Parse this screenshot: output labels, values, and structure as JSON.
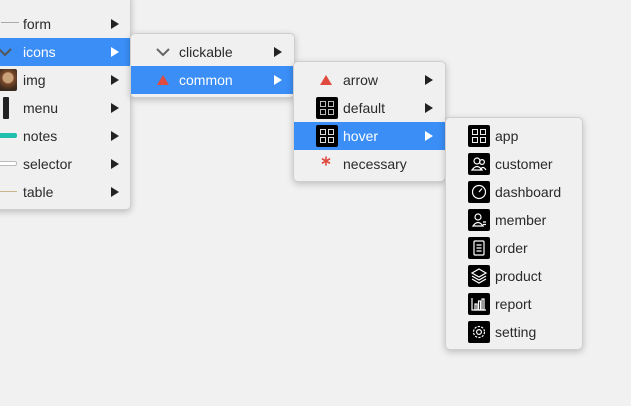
{
  "menu1": {
    "items": [
      {
        "label": "form"
      },
      {
        "label": "icons"
      },
      {
        "label": "img"
      },
      {
        "label": "menu"
      },
      {
        "label": "notes"
      },
      {
        "label": "selector"
      },
      {
        "label": "table"
      }
    ]
  },
  "menu2": {
    "items": [
      {
        "label": "clickable"
      },
      {
        "label": "common"
      }
    ]
  },
  "menu3": {
    "items": [
      {
        "label": "arrow"
      },
      {
        "label": "default"
      },
      {
        "label": "hover"
      },
      {
        "label": "necessary"
      }
    ]
  },
  "menu4": {
    "items": [
      {
        "label": "app"
      },
      {
        "label": "customer"
      },
      {
        "label": "dashboard"
      },
      {
        "label": "member"
      },
      {
        "label": "order"
      },
      {
        "label": "product"
      },
      {
        "label": "report"
      },
      {
        "label": "setting"
      }
    ]
  },
  "colors": {
    "highlight": "#3a8ef6",
    "menu_background": "#f0f0f0",
    "teal_bar": "#1fbfae",
    "red_triangle": "#e04a3f"
  }
}
